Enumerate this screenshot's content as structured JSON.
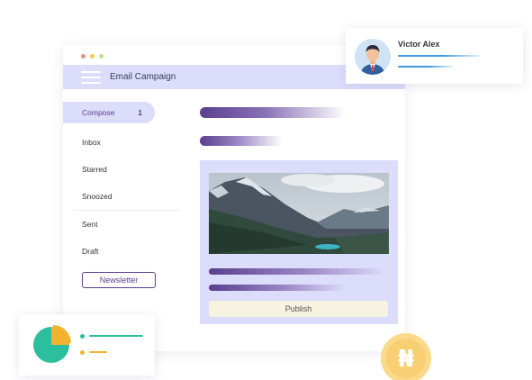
{
  "window": {
    "dots": [
      "#f28b82",
      "#f7c948",
      "#b5e48c"
    ],
    "title": "Email Campaign"
  },
  "sidebar": {
    "items": [
      {
        "label": "Compose",
        "count": "1"
      },
      {
        "label": "Inbox"
      },
      {
        "label": "Starred"
      },
      {
        "label": "Snoozed"
      },
      {
        "label": "Sent"
      },
      {
        "label": "Draft"
      }
    ],
    "newsletter_label": "Newsletter"
  },
  "editor": {
    "publish_label": "Publish",
    "image_icon": "mountain-landscape"
  },
  "profile": {
    "name": "Victor Alex",
    "avatar_icon": "user-avatar-icon"
  },
  "stats": {
    "chart_icon": "pie-chart-icon"
  },
  "currency": {
    "icon": "naira-coin-icon",
    "symbol": "₦"
  },
  "colors": {
    "accent": "#5a3f8f",
    "panel": "#dcdcfb",
    "teal": "#2bbf9e",
    "amber": "#f3b22d",
    "blue": "#3d9be0",
    "coin": "#fbd98a"
  }
}
